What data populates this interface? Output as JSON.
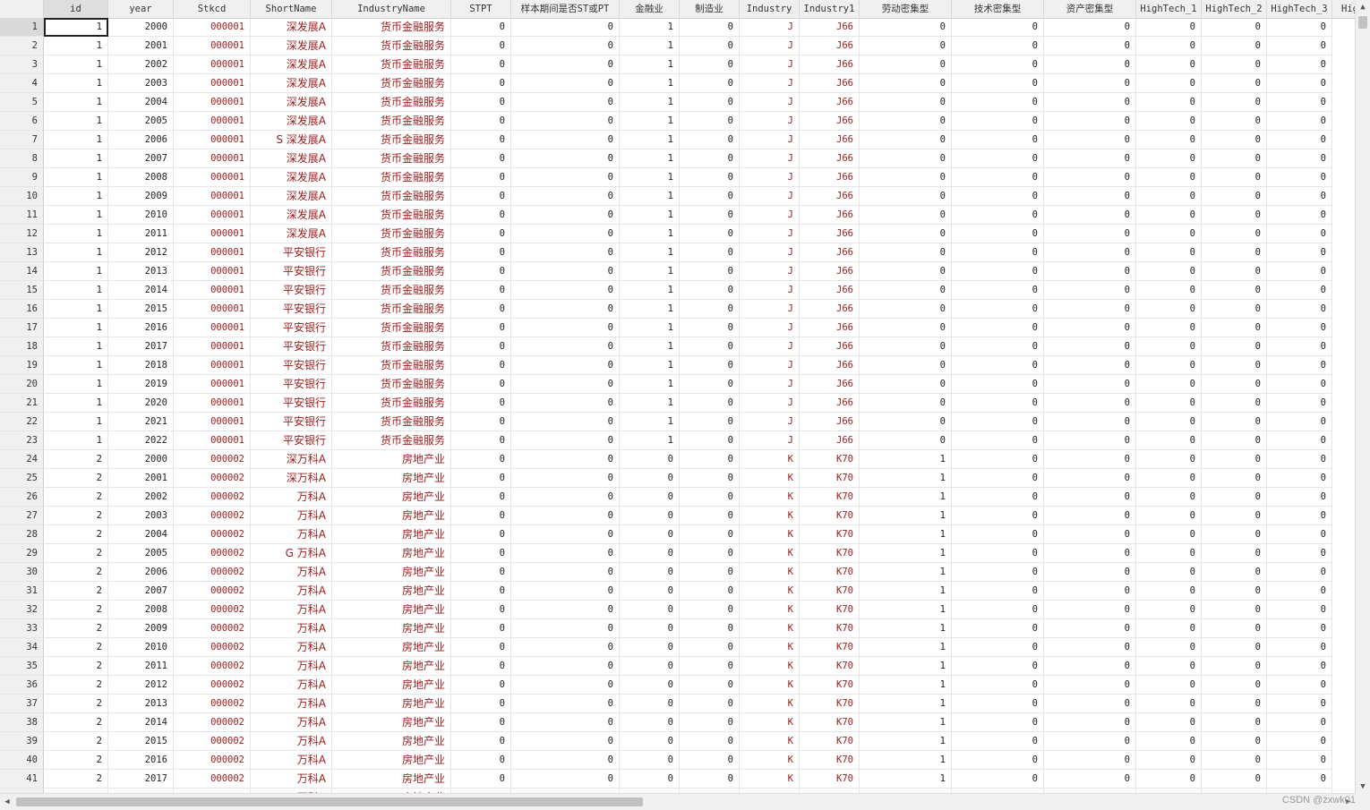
{
  "columns": [
    "id",
    "year",
    "Stkcd",
    "ShortName",
    "IndustryName",
    "STPT",
    "样本期间是否ST或PT",
    "金融业",
    "制造业",
    "Industry",
    "Industry1",
    "劳动密集型",
    "技术密集型",
    "资产密集型",
    "HighTech_1",
    "HighTech_2",
    "HighTech_3",
    "Hig"
  ],
  "rows": [
    [
      "1",
      "1",
      "2000",
      "000001",
      "深发展A",
      "货币金融服务",
      "0",
      "0",
      "1",
      "0",
      "J",
      "J66",
      "0",
      "0",
      "0",
      "0",
      "0",
      "0"
    ],
    [
      "2",
      "1",
      "2001",
      "000001",
      "深发展A",
      "货币金融服务",
      "0",
      "0",
      "1",
      "0",
      "J",
      "J66",
      "0",
      "0",
      "0",
      "0",
      "0",
      "0"
    ],
    [
      "3",
      "1",
      "2002",
      "000001",
      "深发展A",
      "货币金融服务",
      "0",
      "0",
      "1",
      "0",
      "J",
      "J66",
      "0",
      "0",
      "0",
      "0",
      "0",
      "0"
    ],
    [
      "4",
      "1",
      "2003",
      "000001",
      "深发展A",
      "货币金融服务",
      "0",
      "0",
      "1",
      "0",
      "J",
      "J66",
      "0",
      "0",
      "0",
      "0",
      "0",
      "0"
    ],
    [
      "5",
      "1",
      "2004",
      "000001",
      "深发展A",
      "货币金融服务",
      "0",
      "0",
      "1",
      "0",
      "J",
      "J66",
      "0",
      "0",
      "0",
      "0",
      "0",
      "0"
    ],
    [
      "6",
      "1",
      "2005",
      "000001",
      "深发展A",
      "货币金融服务",
      "0",
      "0",
      "1",
      "0",
      "J",
      "J66",
      "0",
      "0",
      "0",
      "0",
      "0",
      "0"
    ],
    [
      "7",
      "1",
      "2006",
      "000001",
      "S 深发展A",
      "货币金融服务",
      "0",
      "0",
      "1",
      "0",
      "J",
      "J66",
      "0",
      "0",
      "0",
      "0",
      "0",
      "0"
    ],
    [
      "8",
      "1",
      "2007",
      "000001",
      "深发展A",
      "货币金融服务",
      "0",
      "0",
      "1",
      "0",
      "J",
      "J66",
      "0",
      "0",
      "0",
      "0",
      "0",
      "0"
    ],
    [
      "9",
      "1",
      "2008",
      "000001",
      "深发展A",
      "货币金融服务",
      "0",
      "0",
      "1",
      "0",
      "J",
      "J66",
      "0",
      "0",
      "0",
      "0",
      "0",
      "0"
    ],
    [
      "10",
      "1",
      "2009",
      "000001",
      "深发展A",
      "货币金融服务",
      "0",
      "0",
      "1",
      "0",
      "J",
      "J66",
      "0",
      "0",
      "0",
      "0",
      "0",
      "0"
    ],
    [
      "11",
      "1",
      "2010",
      "000001",
      "深发展A",
      "货币金融服务",
      "0",
      "0",
      "1",
      "0",
      "J",
      "J66",
      "0",
      "0",
      "0",
      "0",
      "0",
      "0"
    ],
    [
      "12",
      "1",
      "2011",
      "000001",
      "深发展A",
      "货币金融服务",
      "0",
      "0",
      "1",
      "0",
      "J",
      "J66",
      "0",
      "0",
      "0",
      "0",
      "0",
      "0"
    ],
    [
      "13",
      "1",
      "2012",
      "000001",
      "平安银行",
      "货币金融服务",
      "0",
      "0",
      "1",
      "0",
      "J",
      "J66",
      "0",
      "0",
      "0",
      "0",
      "0",
      "0"
    ],
    [
      "14",
      "1",
      "2013",
      "000001",
      "平安银行",
      "货币金融服务",
      "0",
      "0",
      "1",
      "0",
      "J",
      "J66",
      "0",
      "0",
      "0",
      "0",
      "0",
      "0"
    ],
    [
      "15",
      "1",
      "2014",
      "000001",
      "平安银行",
      "货币金融服务",
      "0",
      "0",
      "1",
      "0",
      "J",
      "J66",
      "0",
      "0",
      "0",
      "0",
      "0",
      "0"
    ],
    [
      "16",
      "1",
      "2015",
      "000001",
      "平安银行",
      "货币金融服务",
      "0",
      "0",
      "1",
      "0",
      "J",
      "J66",
      "0",
      "0",
      "0",
      "0",
      "0",
      "0"
    ],
    [
      "17",
      "1",
      "2016",
      "000001",
      "平安银行",
      "货币金融服务",
      "0",
      "0",
      "1",
      "0",
      "J",
      "J66",
      "0",
      "0",
      "0",
      "0",
      "0",
      "0"
    ],
    [
      "18",
      "1",
      "2017",
      "000001",
      "平安银行",
      "货币金融服务",
      "0",
      "0",
      "1",
      "0",
      "J",
      "J66",
      "0",
      "0",
      "0",
      "0",
      "0",
      "0"
    ],
    [
      "19",
      "1",
      "2018",
      "000001",
      "平安银行",
      "货币金融服务",
      "0",
      "0",
      "1",
      "0",
      "J",
      "J66",
      "0",
      "0",
      "0",
      "0",
      "0",
      "0"
    ],
    [
      "20",
      "1",
      "2019",
      "000001",
      "平安银行",
      "货币金融服务",
      "0",
      "0",
      "1",
      "0",
      "J",
      "J66",
      "0",
      "0",
      "0",
      "0",
      "0",
      "0"
    ],
    [
      "21",
      "1",
      "2020",
      "000001",
      "平安银行",
      "货币金融服务",
      "0",
      "0",
      "1",
      "0",
      "J",
      "J66",
      "0",
      "0",
      "0",
      "0",
      "0",
      "0"
    ],
    [
      "22",
      "1",
      "2021",
      "000001",
      "平安银行",
      "货币金融服务",
      "0",
      "0",
      "1",
      "0",
      "J",
      "J66",
      "0",
      "0",
      "0",
      "0",
      "0",
      "0"
    ],
    [
      "23",
      "1",
      "2022",
      "000001",
      "平安银行",
      "货币金融服务",
      "0",
      "0",
      "1",
      "0",
      "J",
      "J66",
      "0",
      "0",
      "0",
      "0",
      "0",
      "0"
    ],
    [
      "24",
      "2",
      "2000",
      "000002",
      "深万科A",
      "房地产业",
      "0",
      "0",
      "0",
      "0",
      "K",
      "K70",
      "1",
      "0",
      "0",
      "0",
      "0",
      "0"
    ],
    [
      "25",
      "2",
      "2001",
      "000002",
      "深万科A",
      "房地产业",
      "0",
      "0",
      "0",
      "0",
      "K",
      "K70",
      "1",
      "0",
      "0",
      "0",
      "0",
      "0"
    ],
    [
      "26",
      "2",
      "2002",
      "000002",
      "万科A",
      "房地产业",
      "0",
      "0",
      "0",
      "0",
      "K",
      "K70",
      "1",
      "0",
      "0",
      "0",
      "0",
      "0"
    ],
    [
      "27",
      "2",
      "2003",
      "000002",
      "万科A",
      "房地产业",
      "0",
      "0",
      "0",
      "0",
      "K",
      "K70",
      "1",
      "0",
      "0",
      "0",
      "0",
      "0"
    ],
    [
      "28",
      "2",
      "2004",
      "000002",
      "万科A",
      "房地产业",
      "0",
      "0",
      "0",
      "0",
      "K",
      "K70",
      "1",
      "0",
      "0",
      "0",
      "0",
      "0"
    ],
    [
      "29",
      "2",
      "2005",
      "000002",
      "G 万科A",
      "房地产业",
      "0",
      "0",
      "0",
      "0",
      "K",
      "K70",
      "1",
      "0",
      "0",
      "0",
      "0",
      "0"
    ],
    [
      "30",
      "2",
      "2006",
      "000002",
      "万科A",
      "房地产业",
      "0",
      "0",
      "0",
      "0",
      "K",
      "K70",
      "1",
      "0",
      "0",
      "0",
      "0",
      "0"
    ],
    [
      "31",
      "2",
      "2007",
      "000002",
      "万科A",
      "房地产业",
      "0",
      "0",
      "0",
      "0",
      "K",
      "K70",
      "1",
      "0",
      "0",
      "0",
      "0",
      "0"
    ],
    [
      "32",
      "2",
      "2008",
      "000002",
      "万科A",
      "房地产业",
      "0",
      "0",
      "0",
      "0",
      "K",
      "K70",
      "1",
      "0",
      "0",
      "0",
      "0",
      "0"
    ],
    [
      "33",
      "2",
      "2009",
      "000002",
      "万科A",
      "房地产业",
      "0",
      "0",
      "0",
      "0",
      "K",
      "K70",
      "1",
      "0",
      "0",
      "0",
      "0",
      "0"
    ],
    [
      "34",
      "2",
      "2010",
      "000002",
      "万科A",
      "房地产业",
      "0",
      "0",
      "0",
      "0",
      "K",
      "K70",
      "1",
      "0",
      "0",
      "0",
      "0",
      "0"
    ],
    [
      "35",
      "2",
      "2011",
      "000002",
      "万科A",
      "房地产业",
      "0",
      "0",
      "0",
      "0",
      "K",
      "K70",
      "1",
      "0",
      "0",
      "0",
      "0",
      "0"
    ],
    [
      "36",
      "2",
      "2012",
      "000002",
      "万科A",
      "房地产业",
      "0",
      "0",
      "0",
      "0",
      "K",
      "K70",
      "1",
      "0",
      "0",
      "0",
      "0",
      "0"
    ],
    [
      "37",
      "2",
      "2013",
      "000002",
      "万科A",
      "房地产业",
      "0",
      "0",
      "0",
      "0",
      "K",
      "K70",
      "1",
      "0",
      "0",
      "0",
      "0",
      "0"
    ],
    [
      "38",
      "2",
      "2014",
      "000002",
      "万科A",
      "房地产业",
      "0",
      "0",
      "0",
      "0",
      "K",
      "K70",
      "1",
      "0",
      "0",
      "0",
      "0",
      "0"
    ],
    [
      "39",
      "2",
      "2015",
      "000002",
      "万科A",
      "房地产业",
      "0",
      "0",
      "0",
      "0",
      "K",
      "K70",
      "1",
      "0",
      "0",
      "0",
      "0",
      "0"
    ],
    [
      "40",
      "2",
      "2016",
      "000002",
      "万科A",
      "房地产业",
      "0",
      "0",
      "0",
      "0",
      "K",
      "K70",
      "1",
      "0",
      "0",
      "0",
      "0",
      "0"
    ],
    [
      "41",
      "2",
      "2017",
      "000002",
      "万科A",
      "房地产业",
      "0",
      "0",
      "0",
      "0",
      "K",
      "K70",
      "1",
      "0",
      "0",
      "0",
      "0",
      "0"
    ],
    [
      "",
      "",
      "",
      "",
      "万科A",
      "房地产业",
      "",
      "",
      "",
      "",
      "",
      "",
      "",
      "",
      "",
      "",
      "",
      ""
    ]
  ],
  "string_columns": [
    2,
    3,
    4,
    9,
    10
  ],
  "active_row": 0,
  "active_col": 0,
  "colors": {
    "string_value": "#9b1b1b",
    "header_bg": "#f0f0f0",
    "grid_line": "#e6e6e6"
  },
  "icons": {
    "scroll_up": "triangle-up-icon",
    "scroll_down": "triangle-down-icon",
    "scroll_left": "triangle-left-icon",
    "scroll_right": "triangle-right-icon"
  },
  "watermark": "CSDN @zxwk01"
}
